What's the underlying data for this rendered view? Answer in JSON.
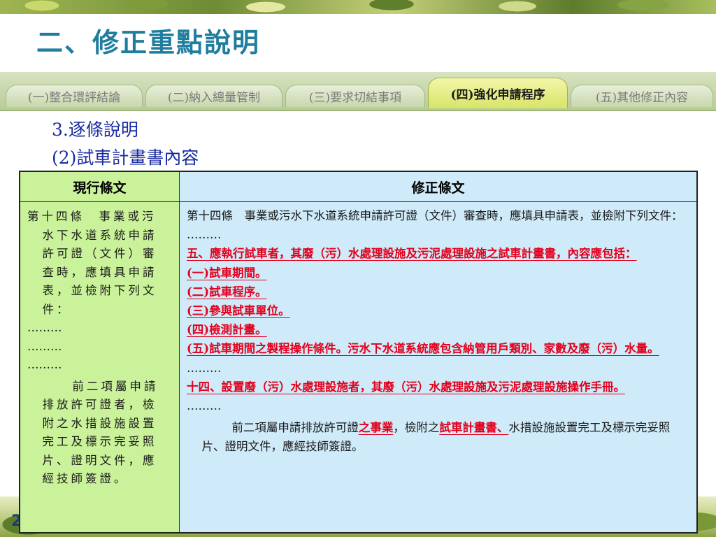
{
  "slide": {
    "title": "二、修正重點說明",
    "page_number": "2"
  },
  "tabs": [
    {
      "label": "(一)整合環評結論",
      "active": false
    },
    {
      "label": "(二)納入總量管制",
      "active": false
    },
    {
      "label": "(三)要求切結事項",
      "active": false
    },
    {
      "label": "(四)強化申請程序",
      "active": true
    },
    {
      "label": "(五)其他修正內容",
      "active": false
    }
  ],
  "section": {
    "heading_1": "3.逐條說明",
    "heading_2": "(2)試車計畫書內容"
  },
  "table": {
    "header_old": "現行條文",
    "header_new": "修正條文",
    "old_lines": [
      "第十四條　事業或污",
      "水下水道系統申請",
      "許可證（文件）審",
      "查時，應填具申請",
      "表，並檢附下列文",
      "件：",
      "………",
      "………",
      "………",
      "前二項屬申請",
      "排放許可證者，檢",
      "附之水措設施設置",
      "完工及標示完妥照",
      "片、證明文件，應",
      "經技師簽證。"
    ],
    "new_intro": "第十四條　事業或污水下水道系統申請許可證（文件）審查時，應填具申請表，並檢附下列文件：",
    "ellipsis": "………",
    "item5": "五、應執行試車者，其廢（污）水處理設施及污泥處理設施之試車計畫書，內容應包括：",
    "sub_items": [
      "(一)試車期間。",
      "(二)試車程序。",
      "(三)參與試車單位。",
      "(四)檢測計畫。",
      "(五)試車期間之製程操作條件。污水下水道系統應包含納管用戶類別、家數及廢（污）水量。"
    ],
    "item14": "十四、設置廢（污）水處理設施者，其廢（污）水處理設施及污泥處理設施操作手冊。",
    "closing": {
      "part1": "前二項屬申請排放許可證",
      "part2_red": "之事業",
      "part3": "，檢附之",
      "part4_red": "試車計畫書、",
      "part5": "水措設施設置完工及標示完妥照片、證明文件，應經技師簽證。"
    }
  },
  "colors": {
    "title": "#1f7d9e",
    "heading": "#1a2ba0",
    "old_column_bg": "#c9f29a",
    "new_column_bg": "#cfeaf8",
    "added_text": "#e4001c",
    "active_tab": "#d8e46a"
  }
}
